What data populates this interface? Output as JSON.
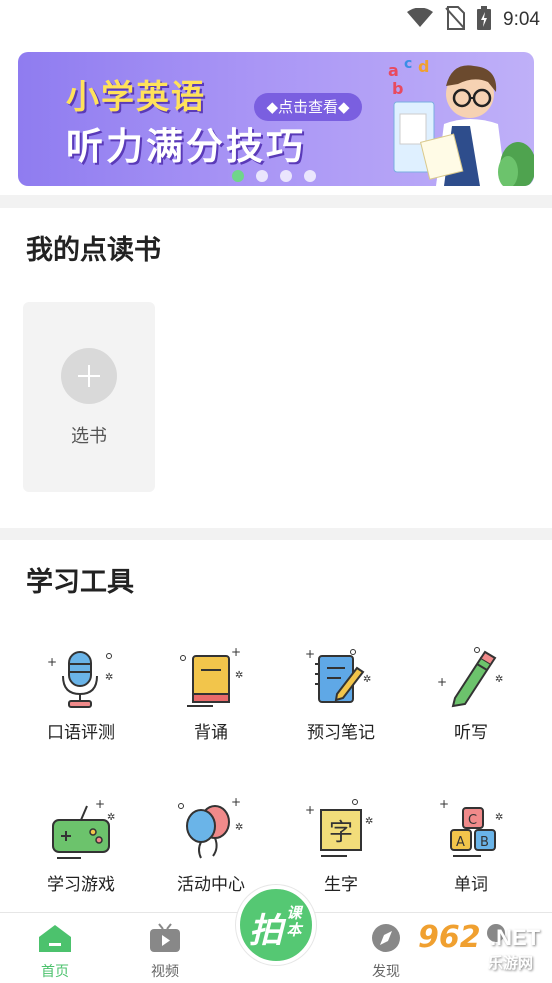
{
  "status_bar": {
    "time": "9:04",
    "icons": [
      "wifi-icon",
      "no-sim-icon",
      "battery-charging-icon"
    ]
  },
  "banner": {
    "title_line1": "小学英语",
    "title_line2": "听力满分技巧",
    "pill_label": "◆点击查看◆",
    "dots": 4,
    "active_dot": 0
  },
  "my_books": {
    "title": "我的点读书",
    "add_label": "选书"
  },
  "tools": {
    "title": "学习工具",
    "items": [
      {
        "label": "口语评测",
        "icon": "microphone-icon"
      },
      {
        "label": "背诵",
        "icon": "book-icon"
      },
      {
        "label": "预习笔记",
        "icon": "notebook-pen-icon"
      },
      {
        "label": "听写",
        "icon": "pencil-icon"
      },
      {
        "label": "学习游戏",
        "icon": "gamepad-icon"
      },
      {
        "label": "活动中心",
        "icon": "balloons-icon"
      },
      {
        "label": "生字",
        "icon": "character-card-icon"
      },
      {
        "label": "单词",
        "icon": "letter-blocks-icon"
      }
    ]
  },
  "bottom_nav": {
    "items": [
      {
        "label": "首页",
        "icon": "home-icon",
        "active": true
      },
      {
        "label": "视频",
        "icon": "tv-icon",
        "active": false
      },
      {
        "label": "发现",
        "icon": "compass-icon",
        "active": false
      }
    ],
    "center_button": {
      "big": "拍",
      "small": "课本"
    }
  },
  "watermark": {
    "number": "962",
    "suffix": ".NET",
    "site": "乐游网"
  },
  "colors": {
    "accent": "#55c873",
    "banner": "#9b88f2",
    "text": "#222222"
  }
}
